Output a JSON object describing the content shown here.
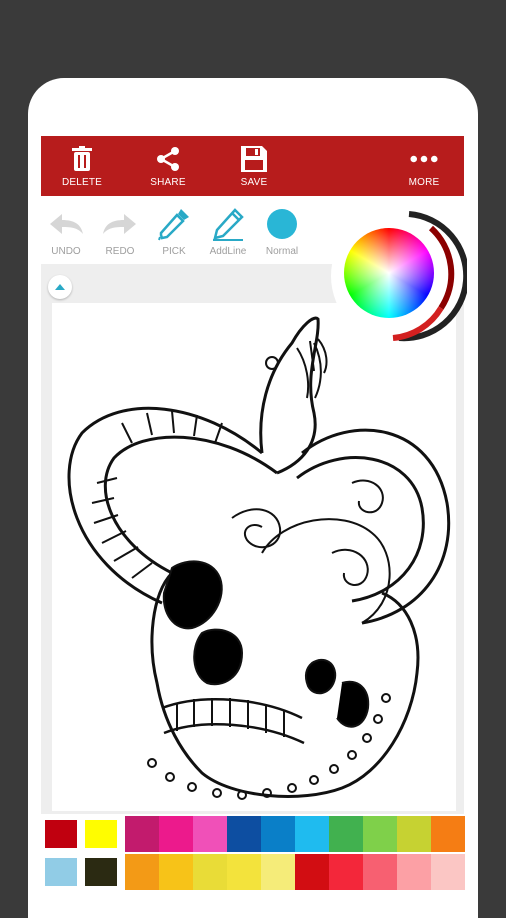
{
  "toolbar": {
    "color": "#b71c1c",
    "buttons": [
      {
        "label": "DELETE",
        "icon": "trash-icon"
      },
      {
        "label": "SHARE",
        "icon": "share-icon"
      },
      {
        "label": "SAVE",
        "icon": "floppy-icon"
      },
      {
        "label": "MORE",
        "icon": "more-dots-icon"
      }
    ]
  },
  "tools": [
    {
      "label": "UNDO",
      "icon": "undo-arrow-icon"
    },
    {
      "label": "REDO",
      "icon": "redo-arrow-icon"
    },
    {
      "label": "PICK",
      "icon": "eyedropper-icon"
    },
    {
      "label": "AddLine",
      "icon": "pencil-icon"
    },
    {
      "label": "Normal",
      "icon": "brush-circle-icon"
    }
  ],
  "current_color": "#29b6d6",
  "artwork": {
    "subject": "snake-and-skull-coloring-page"
  },
  "palette": {
    "selected_pair": [
      "#c0000f",
      "#fffd00",
      "#91cce6",
      "#2b2a12"
    ],
    "swatches_row1": [
      "#c21b6d",
      "#ec1a8c",
      "#f050b8",
      "#0d4ea1",
      "#0a7fc8",
      "#1fbbef",
      "#41b14f",
      "#7fd04a",
      "#c6d232",
      "#f57d14"
    ],
    "swatches_row2": [
      "#f39a16",
      "#f7c318",
      "#e9dc37",
      "#f3e33c",
      "#f5ec79",
      "#d20d12",
      "#f3273a",
      "#f76071",
      "#fca0a5",
      "#fbc6c4"
    ]
  }
}
